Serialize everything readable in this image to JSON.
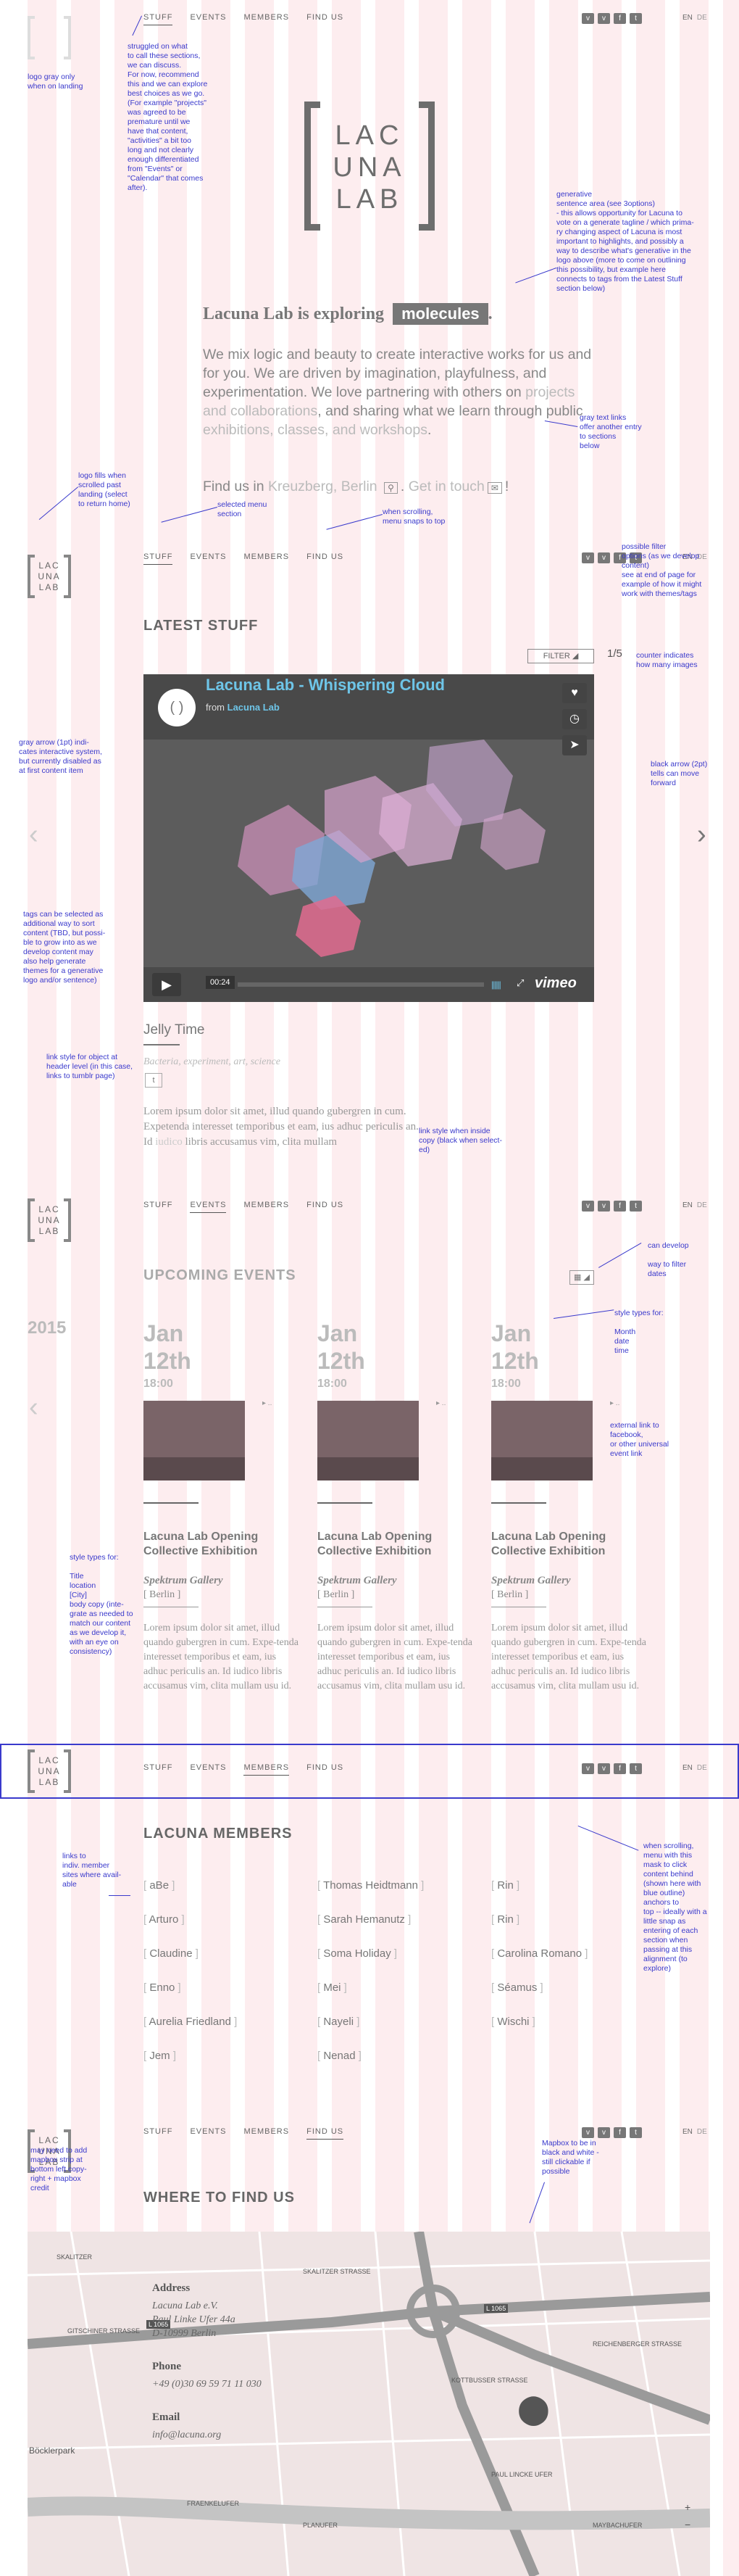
{
  "nav": {
    "items": [
      "STUFF",
      "EVENTS",
      "MEMBERS",
      "FIND US"
    ],
    "lang_active": "EN",
    "lang_other": "DE",
    "social": [
      "v",
      "v",
      "f",
      "t"
    ]
  },
  "logo": {
    "line1": "LAC",
    "line2": "UNA",
    "line3": "LAB"
  },
  "hero": {
    "tagline_prefix": "Lacuna Lab is exploring",
    "tagline_word": "molecules",
    "tagline_suffix": ".",
    "intro_1": "We mix logic and beauty to create interactive works for us and for you. We are driven by imagination, playfulness, and experimentation. We love partnering with others on ",
    "intro_link_1": "projects and collaborations",
    "intro_2": ", and sharing what we learn through public ",
    "intro_link_2": "exhibitions, classes, and workshops",
    "intro_3": ".",
    "findus_prefix": "Find us in",
    "findus_link": "Kreuzberg, Berlin",
    "findus_icon": "⚲",
    "findus_sep": ". ",
    "findus_contact": "Get in touch",
    "findus_mail": "✉",
    "findus_end": "!"
  },
  "latest": {
    "title": "LATEST STUFF",
    "filter": "FILTER",
    "filter_arrow": "◢",
    "counter": "1/5",
    "video_title": "Lacuna Lab - Whispering Cloud",
    "video_from": "from",
    "video_author": "Lacuna Lab",
    "video_time": "00:24",
    "video_brand": "vimeo",
    "item_title": "Jelly Time",
    "item_tags": "Bacteria, experiment, art, science",
    "item_text_1": "Lorem ipsum dolor sit amet, illud quando gubergren in cum. Expetenda interesset temporibus et eam, ius adhuc periculis an. Id ",
    "item_text_link": "iudico",
    "item_text_2": " libris accusamus vim, clita mullam"
  },
  "events": {
    "title": "UPCOMING EVENTS",
    "year": "2015",
    "list": [
      {
        "date_1": "Jan",
        "date_2": "12th",
        "hour": "18:00",
        "link": "▸ ..",
        "title": "Lacuna Lab Opening Collective Exhibition",
        "location": "Spektrum Gallery",
        "city": "[ Berlin ]",
        "body": "Lorem ipsum dolor sit amet, illud quando gubergren in cum. Expe-tenda interesset temporibus et eam, ius adhuc periculis an. Id iudico libris accusamus vim, clita mullam usu id."
      },
      {
        "date_1": "Jan",
        "date_2": "12th",
        "hour": "18:00",
        "link": "▸ ..",
        "title": "Lacuna Lab Opening Collective Exhibition",
        "location": "Spektrum Gallery",
        "city": "[ Berlin ]",
        "body": "Lorem ipsum dolor sit amet, illud quando gubergren in cum. Expe-tenda interesset temporibus et eam, ius adhuc periculis an. Id iudico libris accusamus vim, clita mullam usu id."
      },
      {
        "date_1": "Jan",
        "date_2": "12th",
        "hour": "18:00",
        "link": "▸ ..",
        "title": "Lacuna Lab Opening Collective Exhibition",
        "location": "Spektrum Gallery",
        "city": "[ Berlin ]",
        "body": "Lorem ipsum dolor sit amet, illud quando gubergren in cum. Expe-tenda interesset temporibus et eam, ius adhuc periculis an. Id iudico libris accusamus vim, clita mullam usu id."
      }
    ]
  },
  "members": {
    "title": "LACUNA MEMBERS",
    "col1": [
      "aBe",
      "Arturo",
      "Claudine",
      "Enno",
      "Aurelia Friedland",
      "Jem"
    ],
    "col2": [
      "Thomas Heidtmann",
      "Sarah Hemanutz",
      "Soma Holiday",
      "Mei",
      "Nayeli",
      "Nenad"
    ],
    "col3": [
      "Rin",
      "Rin",
      "Carolina Romano",
      "Séamus",
      "Wischi"
    ]
  },
  "where": {
    "title": "WHERE TO FIND US",
    "address_label": "Address",
    "address_1": "Lacuna Lab e.V.",
    "address_2": "Paul Linke Ufer 44a",
    "address_3": "D-10999 Berlin",
    "phone_label": "Phone",
    "phone": "+49 (0)30 69 59 71 11 030",
    "email_label": "Email",
    "email": "info@lacuna.org",
    "map_labels": [
      "L 1065",
      "L 1065",
      "GITSCHINER STRASSE",
      "SKALITZER STRASSE",
      "KOTTBUSSER STRASSE",
      "REICHENBERGER STRASSE",
      "FRAENKELUFER",
      "MAYBACHUFER",
      "PAUL LINCKE UFER",
      "PLANUFER",
      "Böcklerpark",
      "SKALITZER"
    ],
    "zoom_in": "+",
    "zoom_out": "−"
  },
  "notes": {
    "n1": "logo gray only\nwhen on landing",
    "n2": "struggled on what\nto call these sections,\nwe can discuss.\nFor now, recommend\nthis and we can explore\nbest choices as we go.\n(For example \"projects\"\nwas agreed to be\npremature until we\nhave that content,\n\"activities\" a bit too\nlong and not clearly\nenough differentiated\nfrom \"Events\" or\n\"Calendar\" that comes\nafter).",
    "n3": "generative\nsentence area (see 3options)\n- this allows opportunity for Lacuna to\nvote on a generate tagline / which prima-\nry changing aspect of Lacuna is most\nimportant to highlights, and possibly a\nway to describe what's generative in the\nlogo above (more to come on outlining\nthis possibility, but example here\nconnects to tags from the Latest Stuff\nsection below)",
    "n4": "gray text links\noffer another entry\nto sections\nbelow",
    "n5": "logo fills when\nscrolled past\nlanding (select\nto return home)",
    "n6": "selected menu\nsection",
    "n7": "when scrolling,\nmenu snaps to top",
    "n8": "possible filter\noptions (as we develop\ncontent)\nsee at end of page for\nexample of how it might\nwork with themes/tags",
    "n9": "counter indicates\nhow many images",
    "n10": "gray arrow (1pt) indi-\ncates interactive system,\nbut currently disabled as\nat first content item",
    "n11": "black arrow (2pt)\ntells can move\nforward",
    "n12": "tags can be selected as\nadditional way to sort\ncontent (TBD, but possi-\nble to grow into as we\ndevelop content may\nalso help generate\nthemes for a generative\nlogo and/or sentence)",
    "n13": "link style for object at\nheader level (in this case,\nlinks to tumblr page)",
    "n14": "link style when inside\ncopy (black when select-\ned)",
    "n15": "can develop\n\nway to filter\ndates",
    "n16": "style types for:\n\nMonth\ndate\ntime",
    "n17": "external link to\nfacebook,\nor other universal\nevent link",
    "n18": "style types for:\n\nTitle\nlocation\n[City]\nbody copy (inte-\ngrate as needed to\nmatch our content\nas we develop it,\nwith an eye on\nconsistency)",
    "n19": "links to\nindiv. member\nsites where avail-\nable",
    "n20": "when scrolling,\nmenu with this\nmask to click\ncontent behind\n(shown here with\nblue outline)\nanchors to\ntop -- ideally with a\nlittle snap as\nentering of each\nsection when\npassing at this\nalignment (to\nexplore)",
    "n21": "may need to add\nmapbox strip at\nbottom left copy-\nright + mapbox\ncredit",
    "n22": "Mapbox to be in\nblack and white -\nstill clickable if\npossible"
  }
}
